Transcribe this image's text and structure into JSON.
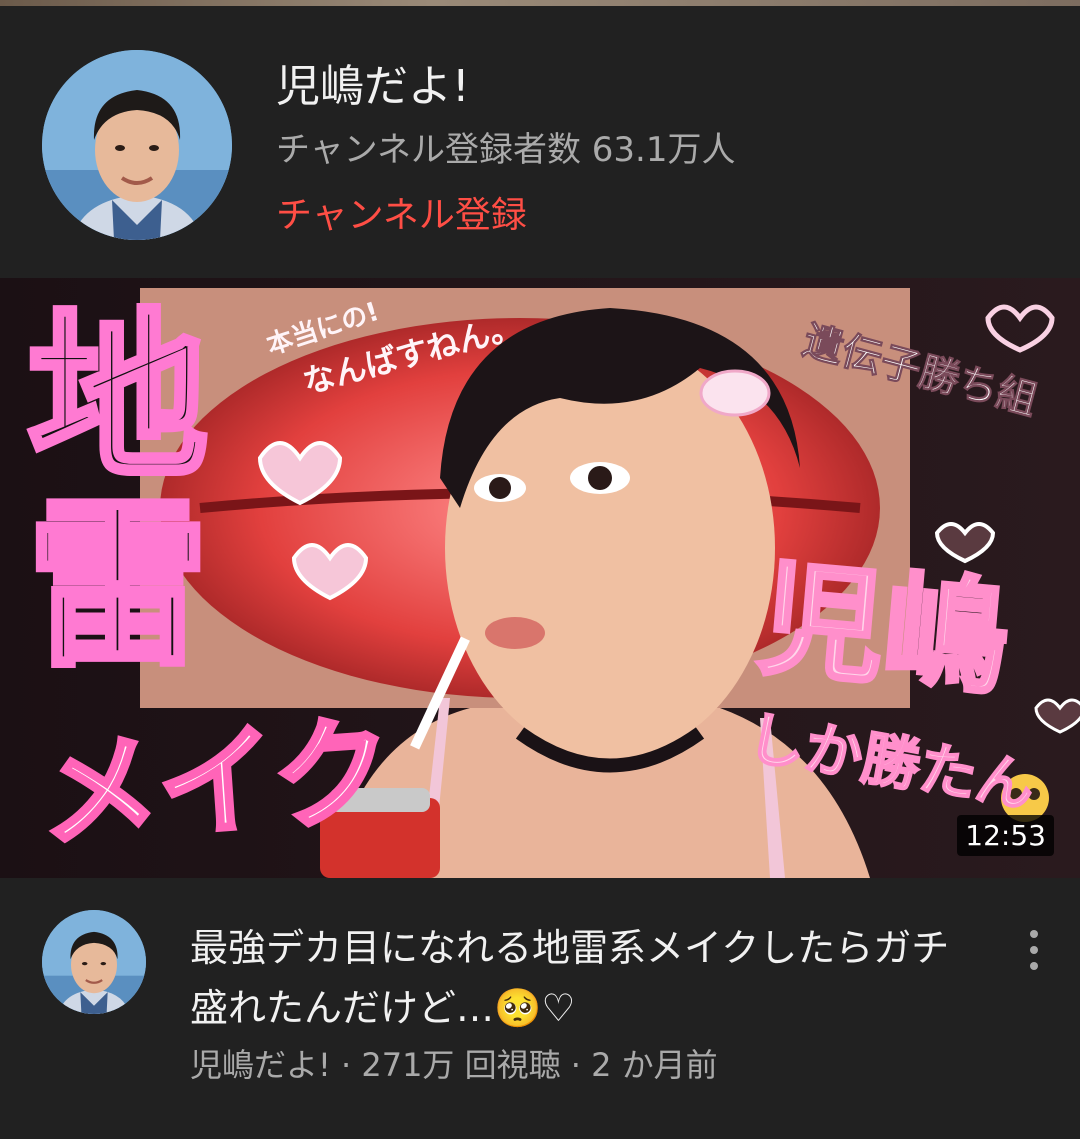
{
  "channel": {
    "name": "児嶋だよ!",
    "subscribers": "チャンネル登録者数 63.1万人",
    "subscribe_label": "チャンネル登録"
  },
  "thumbnail": {
    "title_left_1": "地",
    "title_left_2": "雷",
    "title_bottom": "メイク",
    "title_right": "児嶋",
    "subtitle_right": "しか勝たん",
    "tag_top_right": "遺伝子勝ち組",
    "tag_lips_1": "本当にの!",
    "tag_lips_2": "なんばすねん。",
    "duration": "12:53"
  },
  "video": {
    "title": "最強デカ目になれる地雷系メイクしたらガチ盛れたんだけど…🥺♡",
    "meta": "児嶋だよ! · 271万 回視聴 · 2 か月前"
  }
}
